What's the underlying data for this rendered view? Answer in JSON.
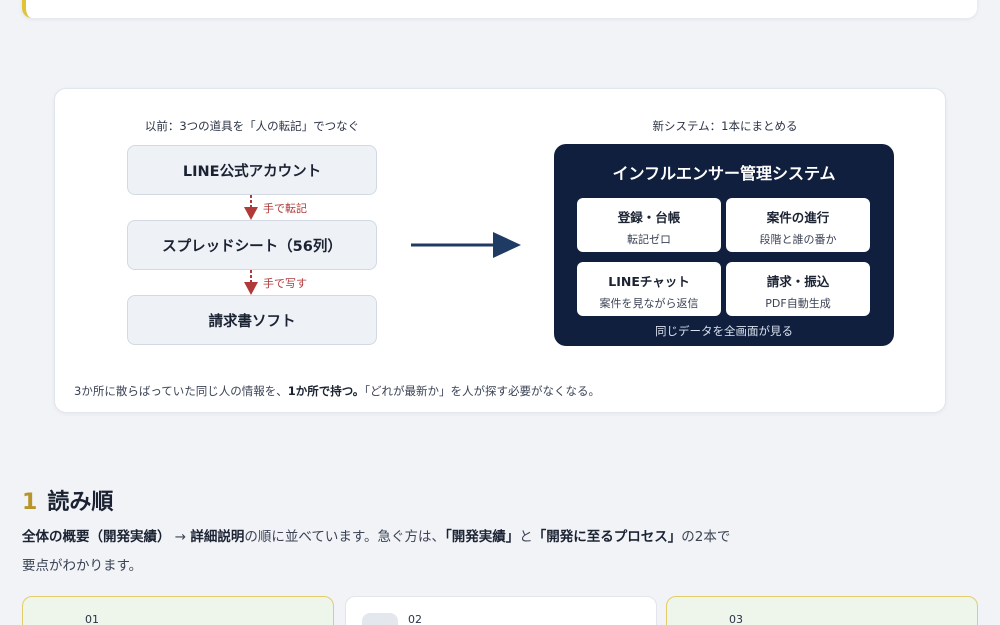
{
  "diagram": {
    "before_title": "以前：3つの道具を「人の転記」でつなぐ",
    "after_title": "新システム：1本にまとめる",
    "old_tools": [
      "LINE公式アカウント",
      "スプレッドシート（56列）",
      "請求書ソフト"
    ],
    "arrow_notes": [
      "手で転記",
      "手で写す"
    ],
    "system": {
      "title": "インフルエンサー管理システム",
      "modules": [
        {
          "title": "登録・台帳",
          "sub": "転記ゼロ"
        },
        {
          "title": "案件の進行",
          "sub": "段階と誰の番か"
        },
        {
          "title": "LINEチャット",
          "sub": "案件を見ながら返信"
        },
        {
          "title": "請求・振込",
          "sub": "PDF自動生成"
        }
      ],
      "footer": "同じデータを全画面が見る"
    },
    "summary": {
      "pre": "3か所に散らばっていた同じ人の情報を、",
      "bold": "1か所で持つ。",
      "post": "「どれが最新か」を人が探す必要がなくなる。"
    },
    "colors": {
      "navy": "#0f1f3d",
      "arrow_red": "#b03a3a",
      "accent_gold": "#b8952a"
    }
  },
  "section": {
    "number": "1",
    "title": "読み順",
    "body": {
      "p1_bold": "全体の概要（開発実績）",
      "p2": " → ",
      "p3_bold": "詳細説明",
      "p4": "の順に並べています。急ぐ方は、",
      "p5_bold": "「開発実績」",
      "p6": "と",
      "p7_bold": "「開発に至るプロセス」",
      "p8": "の2本で",
      "p9": "要点がわかります。"
    },
    "steps": [
      "01",
      "02",
      "03"
    ]
  }
}
